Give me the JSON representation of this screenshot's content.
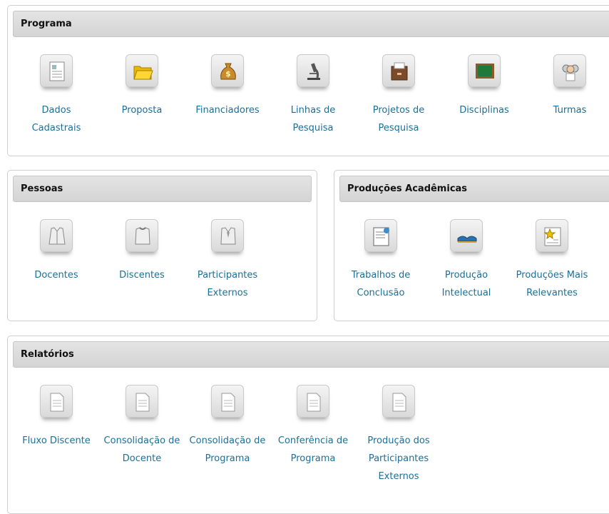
{
  "programa": {
    "title": "Programa",
    "items": [
      {
        "label": "Dados Cadastrais",
        "icon": "document-form-icon"
      },
      {
        "label": "Proposta",
        "icon": "open-folder-icon"
      },
      {
        "label": "Financiadores",
        "icon": "money-bag-icon"
      },
      {
        "label": "Linhas de Pesquisa",
        "icon": "microscope-icon"
      },
      {
        "label": "Projetos de Pesquisa",
        "icon": "filing-cabinet-icon"
      },
      {
        "label": "Disciplinas",
        "icon": "chalkboard-icon"
      },
      {
        "label": "Turmas",
        "icon": "students-icon"
      }
    ]
  },
  "pessoas": {
    "title": "Pessoas",
    "items": [
      {
        "label": "Docentes",
        "icon": "coat-icon"
      },
      {
        "label": "Discentes",
        "icon": "shirt-icon"
      },
      {
        "label": "Participantes Externos",
        "icon": "suit-icon"
      }
    ]
  },
  "producoes": {
    "title": "Produções Acadêmicas",
    "items": [
      {
        "label": "Trabalhos de Conclusão",
        "icon": "certificate-icon"
      },
      {
        "label": "Produção Intelectual",
        "icon": "open-book-icon"
      },
      {
        "label": "Produções Mais Relevantes",
        "icon": "star-document-icon"
      }
    ]
  },
  "relatorios": {
    "title": "Relatórios",
    "items": [
      {
        "label": "Fluxo Discente",
        "icon": "report-icon"
      },
      {
        "label": "Consolidação de Docente",
        "icon": "report-icon"
      },
      {
        "label": "Consolidação de Programa",
        "icon": "report-icon"
      },
      {
        "label": "Conferência de Programa",
        "icon": "report-icon"
      },
      {
        "label": "Produção dos Participantes Externos",
        "icon": "report-icon"
      }
    ]
  },
  "colors": {
    "link": "#1b6f97",
    "header_bg": "#d9d9d9"
  }
}
